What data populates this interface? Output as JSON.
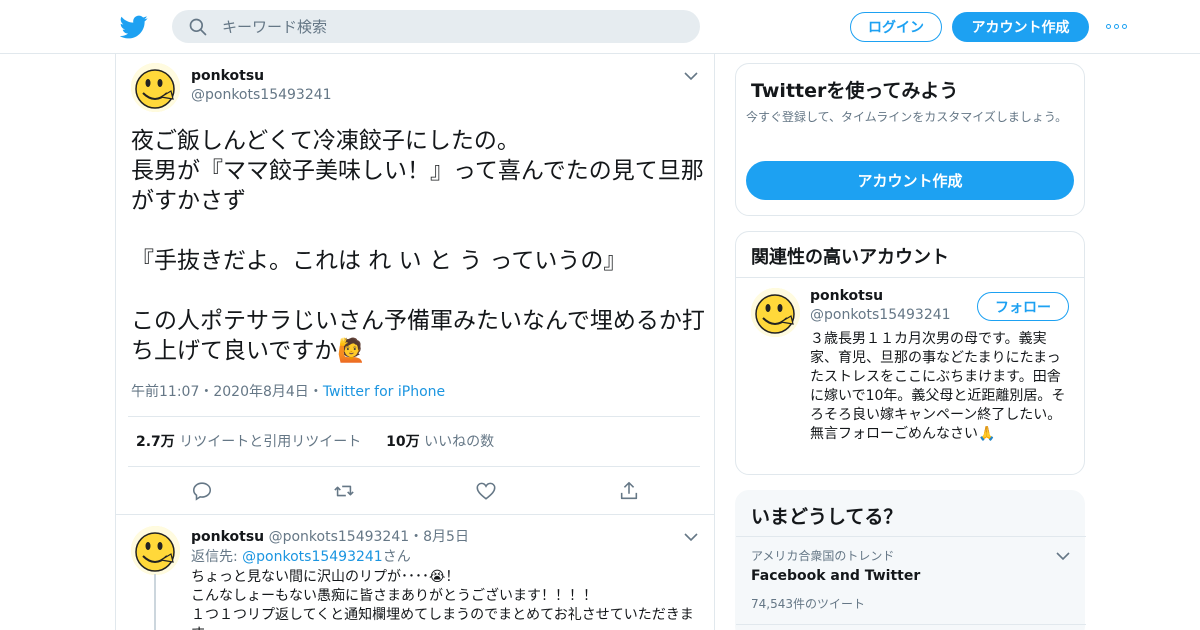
{
  "header": {
    "search_placeholder": "キーワード検索",
    "login_label": "ログイン",
    "signup_label": "アカウント作成",
    "logo_icon": "twitter-bird-icon",
    "accent": "#1da1f2"
  },
  "tweet": {
    "name": "ponkotsu",
    "handle": "@ponkots15493241",
    "text": "夜ご飯しんどくて冷凍餃子にしたの。\n長男が『ママ餃子美味しい！』って喜んでたの見て旦那がすかさず\n\n『手抜きだよ。これは れ い と う っていうの』\n\nこの人ポテサラじいさん予備軍みたいなんで埋めるか打ち上げて良いですか🙋",
    "time": "午前11:07",
    "date": "2020年8月4日",
    "source": "Twitter for iPhone",
    "retweets_count": "2.7万",
    "retweets_label": "リツイートと引用リツイート",
    "likes_count": "10万",
    "likes_label": "いいねの数"
  },
  "reply": {
    "name": "ponkotsu",
    "handle_date": "@ponkots15493241・8月5日",
    "reply_prefix": "返信先: ",
    "reply_to": "@ponkots15493241",
    "reply_suffix": "さん",
    "text": "ちょっと見ない間に沢山のリプが････😭！\nこんなしょーもない愚痴に皆さまありがとうございます！！！！\n１つ１つリプ返してくと通知欄埋めてしまうのでまとめてお礼させていただきます。"
  },
  "sidebar": {
    "try_title": "Twitterを使ってみよう",
    "try_subtitle": "今すぐ登録して、タイムラインをカスタマイズしましょう。",
    "try_button": "アカウント作成",
    "related_title": "関連性の高いアカウント",
    "related_name": "ponkotsu",
    "related_handle": "@ponkots15493241",
    "follow_label": "フォロー",
    "related_bio": "３歳長男１１カ月次男の母です。義実家、育児、旦那の事などたまりにたまったストレスをここにぶちまけます。田舎に嫁いで10年。義父母と近距離別居。そろそろ良い嫁キャンペーン終了したい。無言フォローごめんなさい🙏",
    "trends_title": "いまどうしてる？",
    "trend_location": "アメリカ合衆国のトレンド",
    "trend_name": "Facebook and Twitter",
    "trend_count": "74,543件のツイート"
  }
}
